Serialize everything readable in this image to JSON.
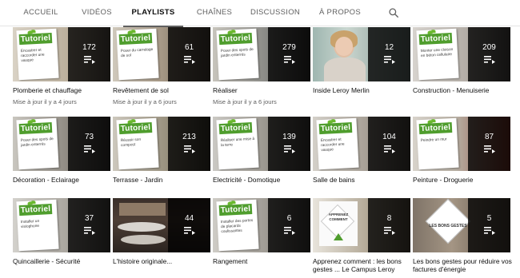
{
  "tabs": [
    {
      "label": "ACCUEIL",
      "active": false
    },
    {
      "label": "VIDÉOS",
      "active": false
    },
    {
      "label": "PLAYLISTS",
      "active": true
    },
    {
      "label": "CHAÎNES",
      "active": false
    },
    {
      "label": "DISCUSSION",
      "active": false
    },
    {
      "label": "À PROPOS",
      "active": false
    }
  ],
  "search_icon": "search-icon",
  "playlist_icon": "playlist-icon",
  "brand_label": "Tutoriel",
  "campus_badge": "APPRENEZ COMMENT",
  "bons_badge": "LES BONS GESTES",
  "colors": {
    "leroy_green": "#4f9d2d",
    "overlay": "rgba(0,0,0,0.80)",
    "active_underline": "#606060"
  },
  "playlists": [
    {
      "title": "Plomberie et chauffage",
      "count": "172",
      "meta": "Mise à jour il y a 4 jours",
      "paper": "Encastrer et raccorder une vasque"
    },
    {
      "title": "Revêtement de sol",
      "count": "61",
      "meta": "Mise à jour il y a 6 jours",
      "paper": "Poser du carrelage de sol"
    },
    {
      "title": "Réaliser",
      "count": "279",
      "meta": "Mise à jour il y a 6 jours",
      "paper": "Poser des spots de jardin enterrés"
    },
    {
      "title": "Inside Leroy Merlin",
      "count": "12",
      "meta": "",
      "paper": ""
    },
    {
      "title": "Construction - Menuiserie",
      "count": "209",
      "meta": "",
      "paper": "Monter une cloison en béton cellulaire"
    },
    {
      "title": "Décoration - Eclairage",
      "count": "73",
      "meta": "",
      "paper": "Poser des spots de jardin enterrés"
    },
    {
      "title": "Terrasse - Jardin",
      "count": "213",
      "meta": "",
      "paper": "Réussir son compost"
    },
    {
      "title": "Electricité - Domotique",
      "count": "139",
      "meta": "",
      "paper": "Réaliser une mise à la terre"
    },
    {
      "title": "Salle de bains",
      "count": "104",
      "meta": "",
      "paper": "Encastrer et raccorder une vasque"
    },
    {
      "title": "Peinture - Droguerie",
      "count": "87",
      "meta": "",
      "paper": "Peindre un mur"
    },
    {
      "title": "Quincaillerie - Sécurité",
      "count": "37",
      "meta": "",
      "paper": "Installer un visiophone"
    },
    {
      "title": "L'histoire originale...",
      "count": "44",
      "meta": "",
      "paper": ""
    },
    {
      "title": "Rangement",
      "count": "6",
      "meta": "",
      "paper": "Installer des portes de placards coulissantes"
    },
    {
      "title": "Apprenez comment : les bons gestes ... Le Campus Leroy",
      "count": "8",
      "meta": "",
      "paper": ""
    },
    {
      "title": "Les bons gestes pour réduire vos factures d'énergie",
      "count": "5",
      "meta": "",
      "paper": ""
    }
  ]
}
